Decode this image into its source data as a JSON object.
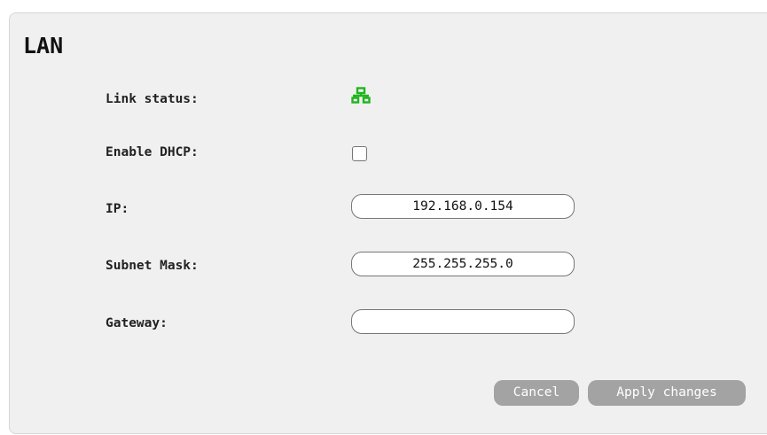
{
  "lan": {
    "title": "LAN",
    "link_status_label": "Link status:",
    "link_status_icon": "network-connected-icon",
    "link_status_color": "#1fb51f",
    "dhcp_label": "Enable DHCP:",
    "dhcp_enabled": false,
    "ip_label": "IP:",
    "ip_value": "192.168.0.154",
    "subnet_label": "Subnet Mask:",
    "subnet_value": "255.255.255.0",
    "gateway_label": "Gateway:",
    "gateway_value": ""
  },
  "actions": {
    "cancel_label": "Cancel",
    "apply_label": "Apply changes",
    "button_color": "#a3a3a3"
  }
}
